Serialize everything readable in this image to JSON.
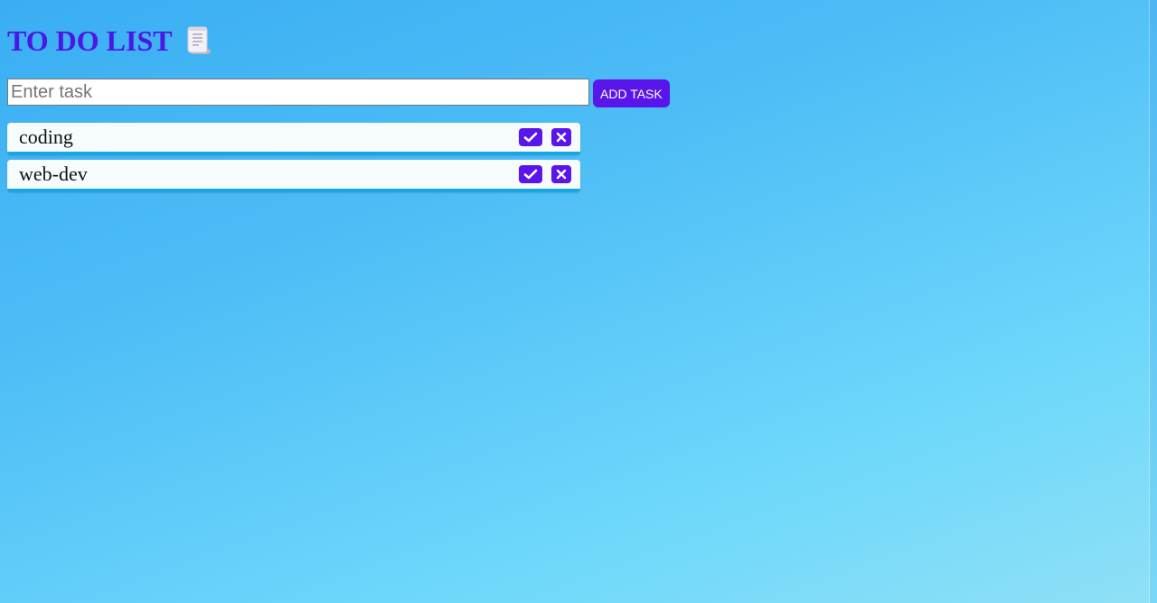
{
  "header": {
    "title": "TO DO LIST",
    "title_icon": "scroll-icon",
    "title_color": "#4a18e6"
  },
  "form": {
    "input_placeholder": "Enter task",
    "input_value": "",
    "add_button_label": "ADD TASK",
    "accent": "#5a16ea"
  },
  "tasks": [
    {
      "text": "coding",
      "complete_icon": "check-icon",
      "delete_icon": "close-icon"
    },
    {
      "text": "web-dev",
      "complete_icon": "check-icon",
      "delete_icon": "close-icon"
    }
  ]
}
